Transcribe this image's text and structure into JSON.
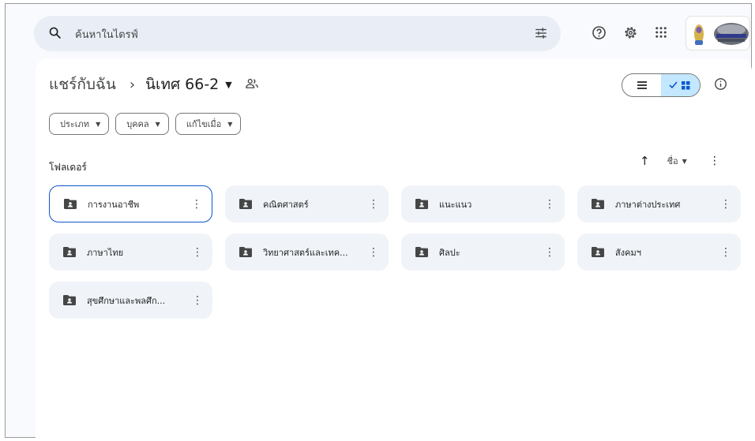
{
  "search": {
    "placeholder": "ค้นหาในไดรฟ์"
  },
  "icons": {
    "search": "search-icon",
    "tune": "tune-icon",
    "help": "help-icon",
    "settings": "settings-icon",
    "apps": "apps-grid-icon",
    "avatar": "account-avatar"
  },
  "breadcrumb": {
    "root": "แชร์กับฉัน",
    "separator": "›",
    "current": "นิเทศ 66-2"
  },
  "filters": [
    {
      "label": "ประเภท"
    },
    {
      "label": "บุคคล"
    },
    {
      "label": "แก้ไขเมื่อ"
    }
  ],
  "section": {
    "title": "โฟลเดอร์"
  },
  "sort": {
    "label": "ชื่อ"
  },
  "folders": [
    {
      "name": "การงานอาชีพ"
    },
    {
      "name": "คณิตศาสตร์"
    },
    {
      "name": "แนะแนว"
    },
    {
      "name": "ภาษาต่างประเทศ"
    },
    {
      "name": "ภาษาไทย"
    },
    {
      "name": "วิทยาศาสตร์และเทค..."
    },
    {
      "name": "ศิลปะ"
    },
    {
      "name": "สังคมฯ"
    },
    {
      "name": "สุขศึกษาและพลศึก..."
    }
  ],
  "colors": {
    "accent": "#0b57d0",
    "selected_view": "#c2e7ff",
    "search_bg": "#e9eef6",
    "folder_bg": "#f0f4f9"
  }
}
